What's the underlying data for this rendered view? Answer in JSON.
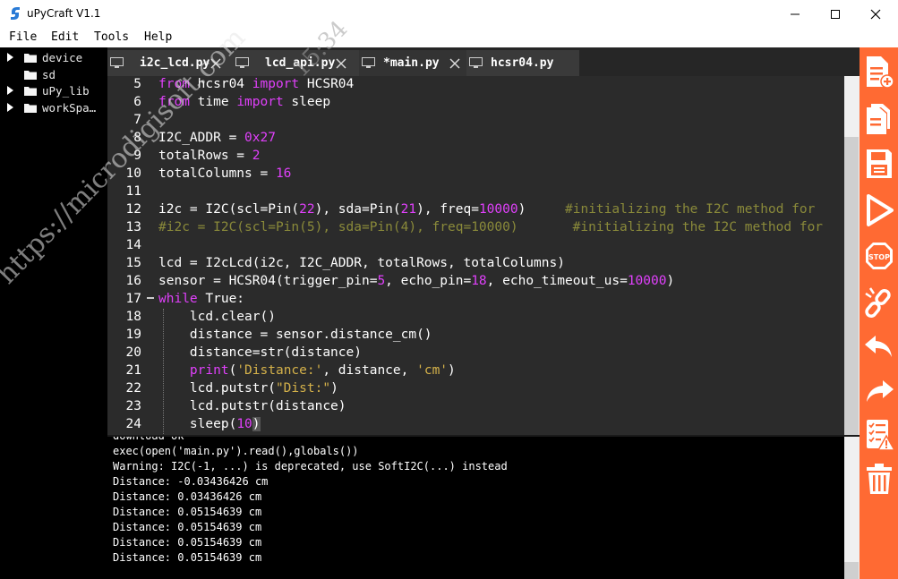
{
  "window": {
    "title": "uPyCraft V1.1",
    "controls": [
      "minimize-icon",
      "maximize-icon",
      "close-icon"
    ]
  },
  "menu": [
    "File",
    "Edit",
    "Tools",
    "Help"
  ],
  "sidebar": {
    "items": [
      {
        "label": "device",
        "expandable": true
      },
      {
        "label": "sd",
        "expandable": false
      },
      {
        "label": "uPy_lib",
        "expandable": true
      },
      {
        "label": "workSpa…",
        "expandable": true
      }
    ]
  },
  "tabs": [
    {
      "label": "i2c_lcd.py",
      "active": false
    },
    {
      "label": "lcd_api.py",
      "active": false
    },
    {
      "label": "*main.py",
      "active": true
    },
    {
      "label": "hcsr04.py",
      "active": false
    }
  ],
  "editor": {
    "lines": [
      {
        "n": "5",
        "tokens": [
          [
            "kw",
            "from"
          ],
          [
            "t",
            " hcsr04 "
          ],
          [
            "kw",
            "import"
          ],
          [
            "t",
            " HCSR04"
          ]
        ]
      },
      {
        "n": "6",
        "tokens": [
          [
            "kw",
            "from"
          ],
          [
            "t",
            " time "
          ],
          [
            "kw",
            "import"
          ],
          [
            "t",
            " sleep"
          ]
        ]
      },
      {
        "n": "7",
        "tokens": []
      },
      {
        "n": "8",
        "tokens": [
          [
            "t",
            "I2C_ADDR = "
          ],
          [
            "num",
            "0x27"
          ]
        ]
      },
      {
        "n": "9",
        "tokens": [
          [
            "t",
            "totalRows = "
          ],
          [
            "num",
            "2"
          ]
        ]
      },
      {
        "n": "10",
        "tokens": [
          [
            "t",
            "totalColumns = "
          ],
          [
            "num",
            "16"
          ]
        ]
      },
      {
        "n": "11",
        "tokens": []
      },
      {
        "n": "12",
        "tokens": [
          [
            "t",
            "i2c = I2C(scl=Pin("
          ],
          [
            "num",
            "22"
          ],
          [
            "t",
            "), sda=Pin("
          ],
          [
            "num",
            "21"
          ],
          [
            "t",
            "), freq="
          ],
          [
            "num",
            "10000"
          ],
          [
            "t",
            ")     "
          ],
          [
            "cmt",
            "#initializing the I2C method for"
          ]
        ]
      },
      {
        "n": "13",
        "tokens": [
          [
            "cmt",
            "#i2c = I2C(scl=Pin(5), sda=Pin(4), freq=10000)       #initializing the I2C method for"
          ]
        ]
      },
      {
        "n": "14",
        "tokens": []
      },
      {
        "n": "15",
        "tokens": [
          [
            "t",
            "lcd = I2cLcd(i2c, I2C_ADDR, totalRows, totalColumns)"
          ]
        ]
      },
      {
        "n": "16",
        "tokens": [
          [
            "t",
            "sensor = HCSR04(trigger_pin="
          ],
          [
            "num",
            "5"
          ],
          [
            "t",
            ", echo_pin="
          ],
          [
            "num",
            "18"
          ],
          [
            "t",
            ", echo_timeout_us="
          ],
          [
            "num",
            "10000"
          ],
          [
            "t",
            ")"
          ]
        ]
      },
      {
        "n": "17",
        "tokens": [
          [
            "kw",
            "while"
          ],
          [
            "t",
            " True:"
          ]
        ]
      },
      {
        "n": "18",
        "tokens": [
          [
            "t",
            "    lcd.clear()"
          ]
        ]
      },
      {
        "n": "19",
        "tokens": [
          [
            "t",
            "    distance = sensor.distance_cm()"
          ]
        ]
      },
      {
        "n": "20",
        "tokens": [
          [
            "t",
            "    distance=str(distance)"
          ]
        ]
      },
      {
        "n": "21",
        "tokens": [
          [
            "t",
            "    "
          ],
          [
            "kw",
            "print"
          ],
          [
            "t",
            "("
          ],
          [
            "str",
            "'Distance:'"
          ],
          [
            "t",
            ", distance, "
          ],
          [
            "str",
            "'cm'"
          ],
          [
            "t",
            ")"
          ]
        ]
      },
      {
        "n": "22",
        "tokens": [
          [
            "t",
            "    lcd.putstr("
          ],
          [
            "str",
            "\"Dist:\""
          ],
          [
            "t",
            ")"
          ]
        ]
      },
      {
        "n": "23",
        "tokens": [
          [
            "t",
            "    lcd.putstr(distance)"
          ]
        ]
      },
      {
        "n": "24",
        "tokens": [
          [
            "t",
            "    sleep("
          ],
          [
            "num",
            "10"
          ],
          [
            "cur",
            ")"
          ]
        ]
      }
    ]
  },
  "terminal": {
    "lines": [
      "download ok",
      "exec(open('main.py').read(),globals())",
      "Warning: I2C(-1, ...) is deprecated, use SoftI2C(...) instead",
      "Distance: -0.03436426 cm",
      "Distance: 0.03436426 cm",
      "Distance: 0.05154639 cm",
      "Distance: 0.05154639 cm",
      "Distance: 0.05154639 cm",
      "Distance: 0.05154639 cm"
    ]
  },
  "toolbar": {
    "buttons": [
      "new-file-icon",
      "open-file-icon",
      "save-icon",
      "run-icon",
      "stop-icon",
      "connect-icon",
      "undo-icon",
      "redo-icon",
      "syntax-check-icon",
      "clear-icon"
    ]
  },
  "watermark": {
    "text": "https://microdigisoft.com",
    "time": "15:34"
  },
  "colors": {
    "toolbar": "#ff6a33",
    "keyword": "#e040fb",
    "string": "#d4b14a",
    "comment": "#8a8a3a",
    "active_tab_underline": "#f08c3c"
  }
}
